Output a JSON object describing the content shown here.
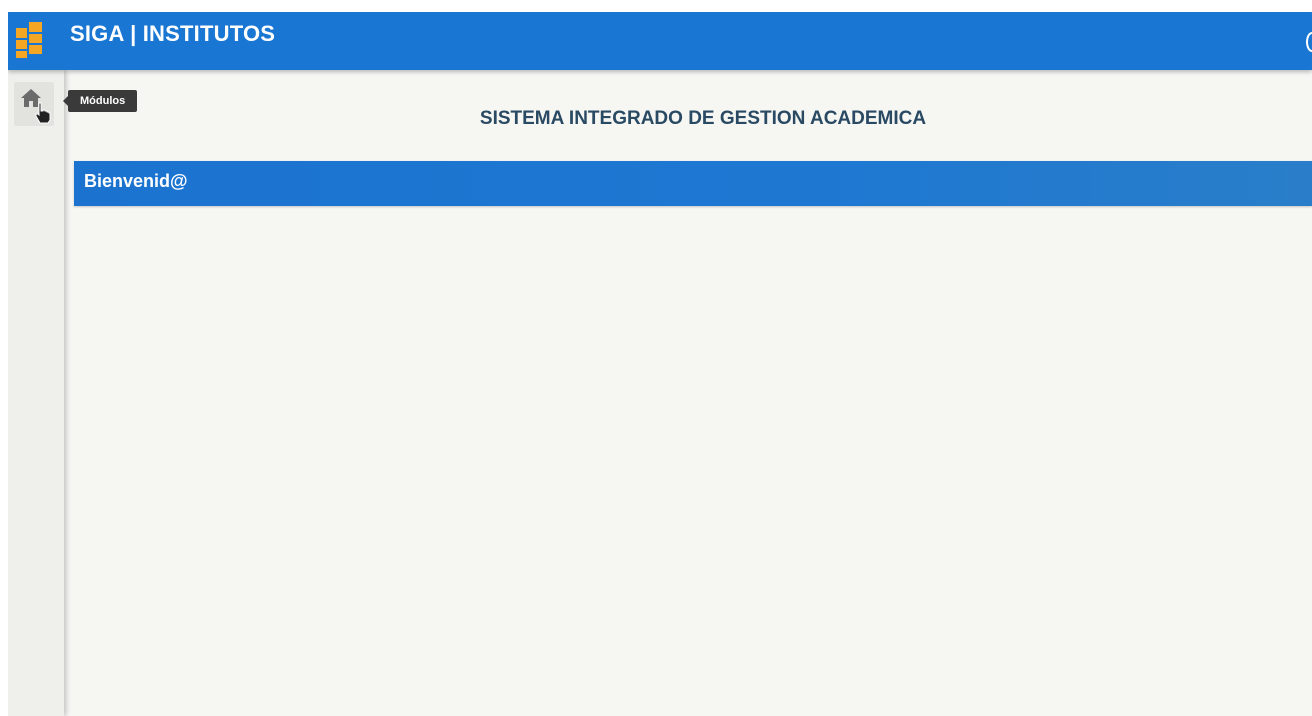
{
  "header": {
    "app_title": "SIGA | INSTITUTOS",
    "logo_icon": "siga-blocks-logo",
    "bar_color": "#1976d2"
  },
  "sidebar": {
    "home_icon": "home-icon",
    "tooltip": "Módulos"
  },
  "main": {
    "system_title": "SISTEMA INTEGRADO DE GESTION ACADEMICA",
    "welcome": "Bienvenid@"
  },
  "colors": {
    "accent": "#1976d2",
    "logo": "#f5a623",
    "title_text": "#2a4a63",
    "background": "#f6f6f3"
  }
}
